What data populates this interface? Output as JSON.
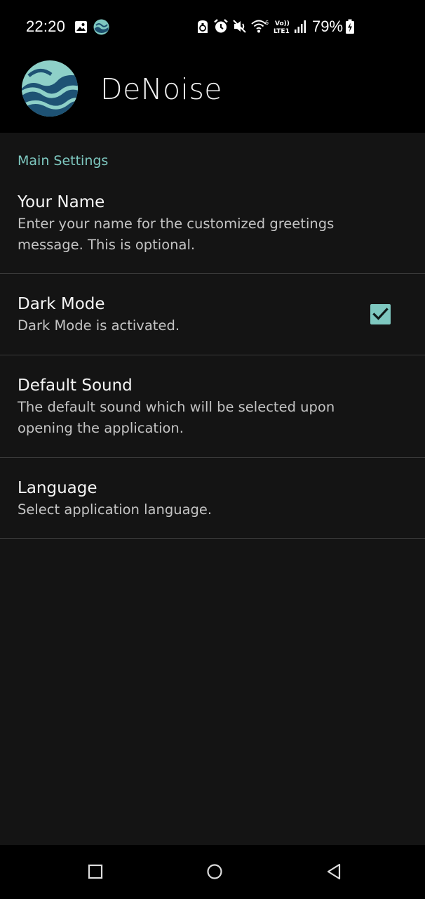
{
  "status_bar": {
    "time": "22:20",
    "battery_percent": "79%",
    "icons": [
      "image-icon",
      "denoise-app-icon",
      "recycle-icon",
      "alarm-icon",
      "mute-icon",
      "wifi-icon",
      "volte-icon",
      "signal-icon",
      "battery-charging-icon"
    ],
    "network_label": "Vo)) LTE1"
  },
  "app_bar": {
    "title": "DeNoise",
    "logo_icon": "denoise-logo-icon"
  },
  "settings": {
    "section_header": "Main Settings",
    "items": [
      {
        "title": "Your Name",
        "summary": "Enter your name for the customized greetings message. This is optional."
      },
      {
        "title": "Dark Mode",
        "summary": "Dark Mode is activated.",
        "checked": true
      },
      {
        "title": "Default Sound",
        "summary": "The default sound which will be selected upon opening the application."
      },
      {
        "title": "Language",
        "summary": "Select application language."
      }
    ]
  },
  "nav_bar": {
    "icons": [
      "recents-square-icon",
      "home-circle-icon",
      "back-triangle-icon"
    ]
  },
  "colors": {
    "accent": "#7ec8c0",
    "background": "#141414",
    "bar_background": "#000000",
    "divider": "#3a3a3a"
  }
}
